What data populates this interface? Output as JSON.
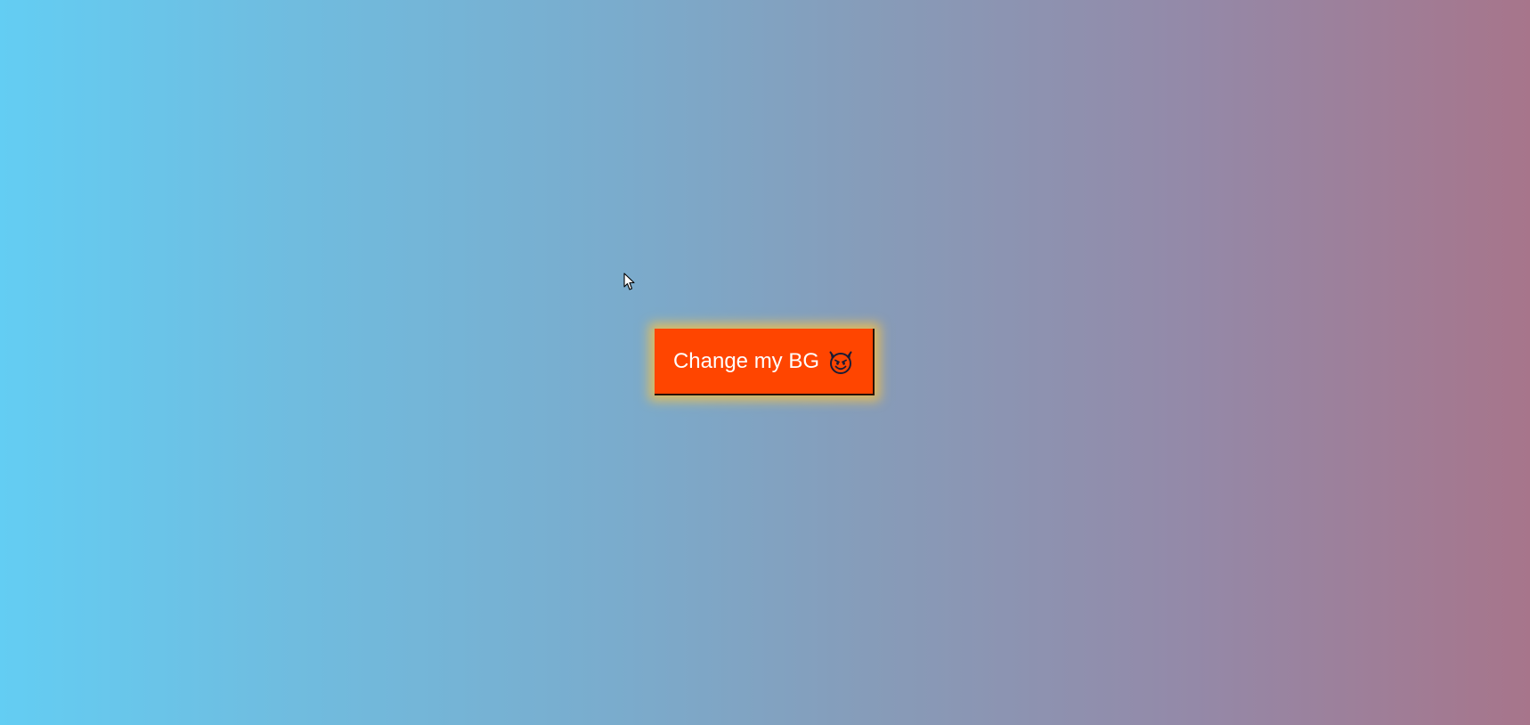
{
  "main": {
    "button_label": "Change my BG",
    "button_icon": "smiling-face-with-horns-icon"
  },
  "colors": {
    "button_background": "#ff4500",
    "button_glow": "#ffc43c",
    "background_gradient": [
      "#63cdf3",
      "#7aaccd",
      "#9489a8",
      "#a7758b"
    ]
  }
}
